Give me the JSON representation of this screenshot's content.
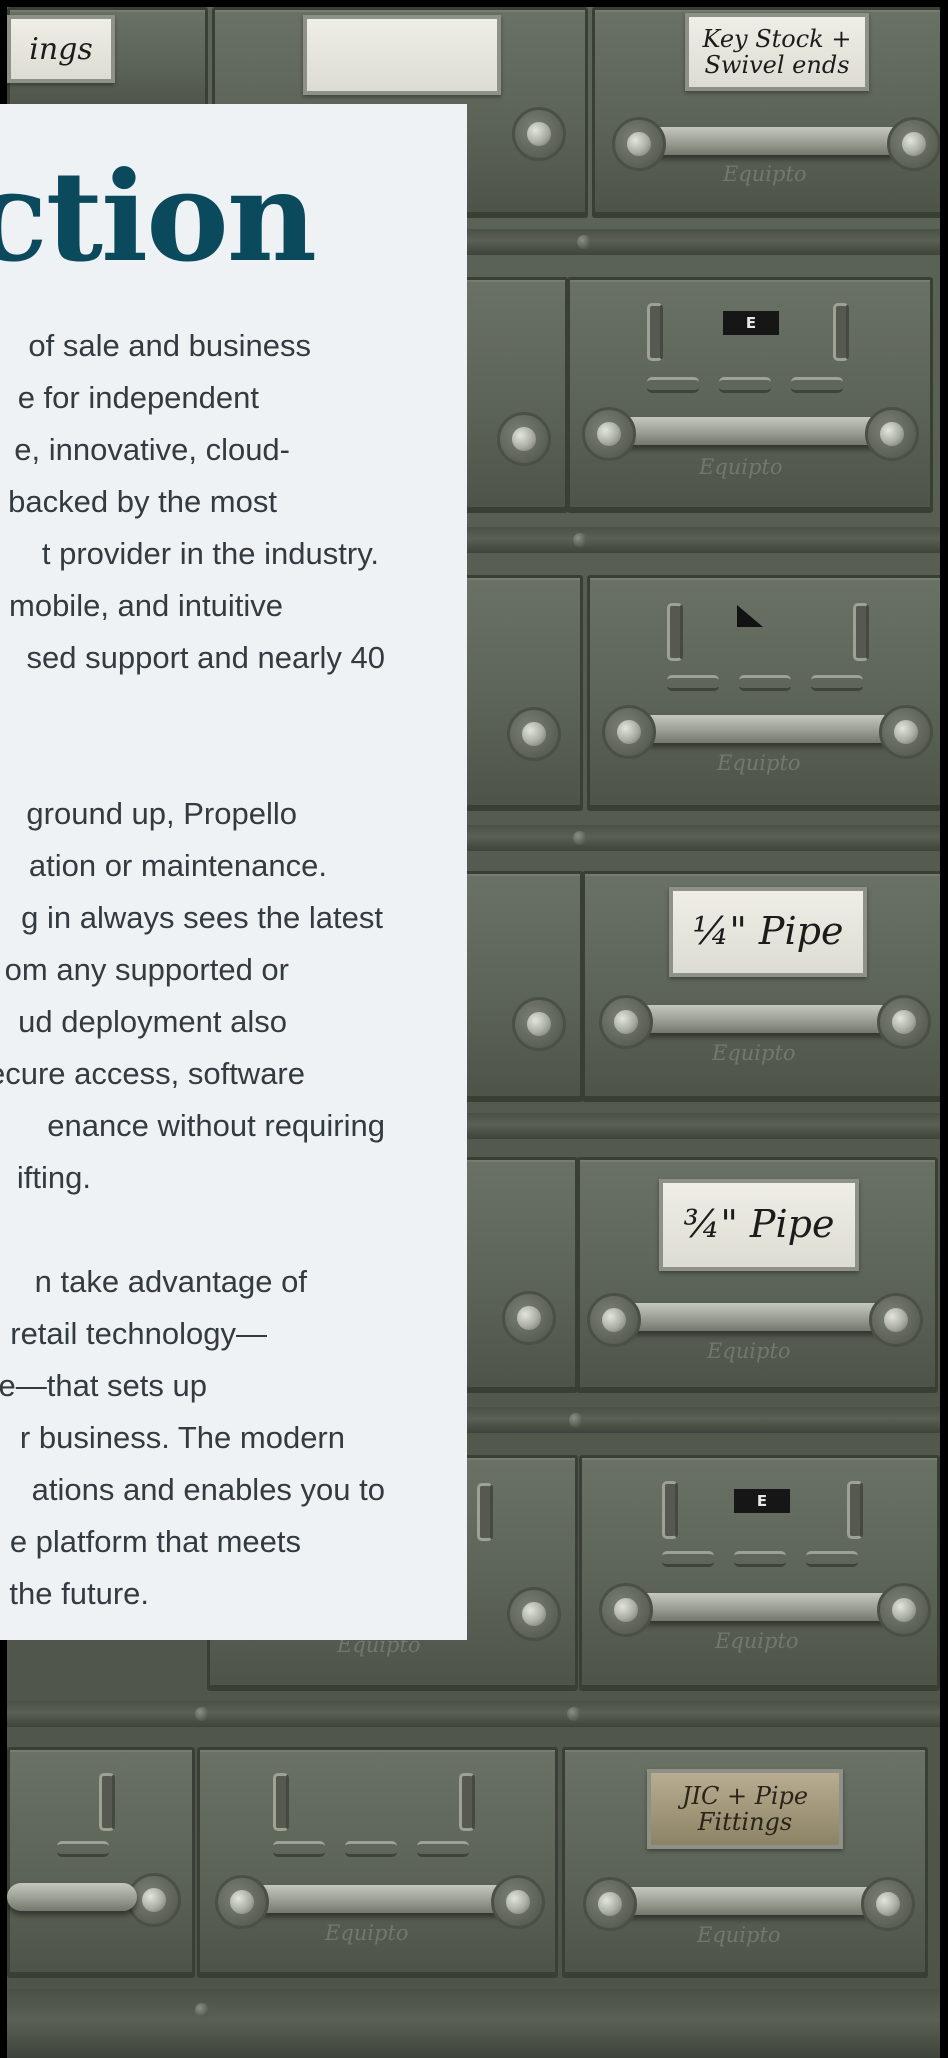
{
  "intro": {
    "heading": "uction",
    "paragraphs": [
      {
        "lines": [
          "of sale and business",
          "e for independent",
          "e, innovative, cloud-",
          "backed by the most",
          "t provider in the industry.",
          "mobile, and intuitive",
          "sed support and nearly 40"
        ]
      },
      {
        "lines": [
          "ground up, Propello",
          "ation or maintenance.",
          "g in always sees the latest",
          "om any supported or",
          "ud deployment also",
          "ecure access, software",
          "enance without requiring",
          "ifting."
        ]
      },
      {
        "lines": [
          "n take advantage  of",
          "ern retail technology—",
          "device—that sets up",
          "r business. The modern",
          "ations and enables you to",
          "e platform that meets",
          "the future."
        ]
      }
    ]
  },
  "cabinet_labels": {
    "label_top_left": "ings",
    "label_key_stock": "Key Stock + Swivel ends",
    "label_quarter_pipe": "¼\" Pipe",
    "label_three_quarter_pipe": "¾\" Pipe",
    "label_jic": "JIC + Pipe Fittings",
    "tag_e": "E",
    "brand": "Equipto"
  },
  "colors": {
    "heading": "#0b4a5d",
    "panel_background": "#eef2f5",
    "body_text": "#333a40"
  }
}
